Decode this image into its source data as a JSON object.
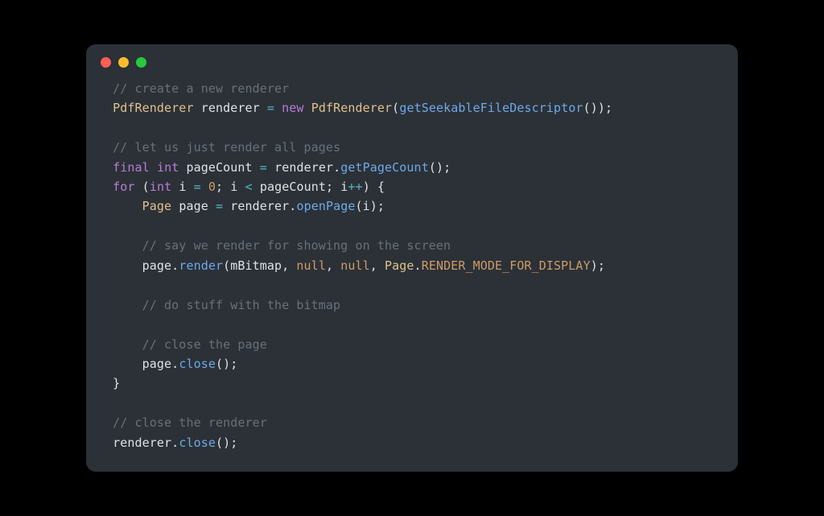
{
  "window": {
    "dots": [
      "red",
      "yellow",
      "green"
    ]
  },
  "code": {
    "tokens": [
      [
        {
          "cls": "tok-comment",
          "text": " // create a new renderer"
        }
      ],
      [
        {
          "cls": "tok-type",
          "text": " PdfRenderer"
        },
        {
          "cls": "tok-ident",
          "text": " renderer "
        },
        {
          "cls": "tok-op",
          "text": "="
        },
        {
          "cls": "tok-ident",
          "text": " "
        },
        {
          "cls": "tok-keyword",
          "text": "new"
        },
        {
          "cls": "tok-ident",
          "text": " "
        },
        {
          "cls": "tok-type",
          "text": "PdfRenderer"
        },
        {
          "cls": "tok-punct",
          "text": "("
        },
        {
          "cls": "tok-func",
          "text": "getSeekableFileDescriptor"
        },
        {
          "cls": "tok-punct",
          "text": "());"
        }
      ],
      [
        {
          "cls": "tok-plain",
          "text": ""
        }
      ],
      [
        {
          "cls": "tok-comment",
          "text": " // let us just render all pages"
        }
      ],
      [
        {
          "cls": "tok-ident",
          "text": " "
        },
        {
          "cls": "tok-keyword",
          "text": "final"
        },
        {
          "cls": "tok-ident",
          "text": " "
        },
        {
          "cls": "tok-keyword",
          "text": "int"
        },
        {
          "cls": "tok-ident",
          "text": " pageCount "
        },
        {
          "cls": "tok-op",
          "text": "="
        },
        {
          "cls": "tok-ident",
          "text": " renderer."
        },
        {
          "cls": "tok-func",
          "text": "getPageCount"
        },
        {
          "cls": "tok-punct",
          "text": "();"
        }
      ],
      [
        {
          "cls": "tok-ident",
          "text": " "
        },
        {
          "cls": "tok-keyword",
          "text": "for"
        },
        {
          "cls": "tok-punct",
          "text": " ("
        },
        {
          "cls": "tok-keyword",
          "text": "int"
        },
        {
          "cls": "tok-ident",
          "text": " i "
        },
        {
          "cls": "tok-op",
          "text": "="
        },
        {
          "cls": "tok-ident",
          "text": " "
        },
        {
          "cls": "tok-number",
          "text": "0"
        },
        {
          "cls": "tok-punct",
          "text": "; i "
        },
        {
          "cls": "tok-op",
          "text": "<"
        },
        {
          "cls": "tok-ident",
          "text": " pageCount; i"
        },
        {
          "cls": "tok-op",
          "text": "++"
        },
        {
          "cls": "tok-punct",
          "text": ") {"
        }
      ],
      [
        {
          "cls": "tok-type",
          "text": "     Page"
        },
        {
          "cls": "tok-ident",
          "text": " page "
        },
        {
          "cls": "tok-op",
          "text": "="
        },
        {
          "cls": "tok-ident",
          "text": " renderer."
        },
        {
          "cls": "tok-func",
          "text": "openPage"
        },
        {
          "cls": "tok-punct",
          "text": "(i);"
        }
      ],
      [
        {
          "cls": "tok-plain",
          "text": ""
        }
      ],
      [
        {
          "cls": "tok-comment",
          "text": "     // say we render for showing on the screen"
        }
      ],
      [
        {
          "cls": "tok-ident",
          "text": "     page."
        },
        {
          "cls": "tok-func",
          "text": "render"
        },
        {
          "cls": "tok-punct",
          "text": "(mBitmap, "
        },
        {
          "cls": "tok-null",
          "text": "null"
        },
        {
          "cls": "tok-punct",
          "text": ", "
        },
        {
          "cls": "tok-null",
          "text": "null"
        },
        {
          "cls": "tok-punct",
          "text": ", "
        },
        {
          "cls": "tok-type",
          "text": "Page"
        },
        {
          "cls": "tok-punct",
          "text": "."
        },
        {
          "cls": "tok-const",
          "text": "RENDER_MODE_FOR_DISPLAY"
        },
        {
          "cls": "tok-punct",
          "text": ");"
        }
      ],
      [
        {
          "cls": "tok-plain",
          "text": ""
        }
      ],
      [
        {
          "cls": "tok-comment",
          "text": "     // do stuff with the bitmap"
        }
      ],
      [
        {
          "cls": "tok-plain",
          "text": ""
        }
      ],
      [
        {
          "cls": "tok-comment",
          "text": "     // close the page"
        }
      ],
      [
        {
          "cls": "tok-ident",
          "text": "     page."
        },
        {
          "cls": "tok-func",
          "text": "close"
        },
        {
          "cls": "tok-punct",
          "text": "();"
        }
      ],
      [
        {
          "cls": "tok-punct",
          "text": " }"
        }
      ],
      [
        {
          "cls": "tok-plain",
          "text": ""
        }
      ],
      [
        {
          "cls": "tok-comment",
          "text": " // close the renderer"
        }
      ],
      [
        {
          "cls": "tok-ident",
          "text": " renderer."
        },
        {
          "cls": "tok-func",
          "text": "close"
        },
        {
          "cls": "tok-punct",
          "text": "();"
        }
      ]
    ]
  }
}
